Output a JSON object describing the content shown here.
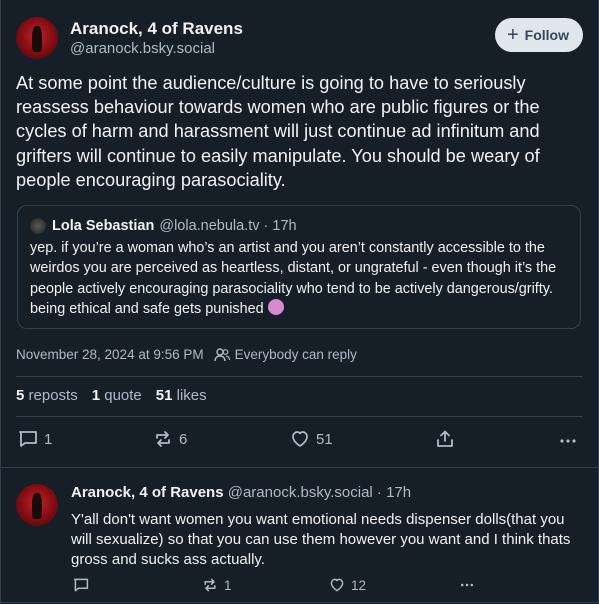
{
  "post": {
    "display_name": "Aranock, 4 of Ravens",
    "handle": "@aranock.bsky.social",
    "follow_label": "Follow",
    "text": "At some point the audience/culture is going to have to seriously reassess behaviour towards women who are public figures or the cycles of harm and harassment will just continue ad infinitum and grifters will continue to easily manipulate. You should be weary of people encouraging parasociality.",
    "quote": {
      "display_name": "Lola Sebastian",
      "handle_time": "@lola.nebula.tv · 17h",
      "text": "yep. if you’re a woman who’s an artist and you aren’t constantly accessible to the weirdos you are perceived as heartless, distant, or ungrateful - even though it’s the people actively encouraging parasociality who tend to be actively dangerous/grifty. being ethical and safe gets punished"
    },
    "timestamp": "November 28, 2024 at 9:56 PM",
    "reply_setting": "Everybody can reply",
    "stats": {
      "reposts_count": "5",
      "reposts_label": "reposts",
      "quotes_count": "1",
      "quotes_label": "quote",
      "likes_count": "51",
      "likes_label": "likes"
    },
    "actions": {
      "replies": "1",
      "reposts": "6",
      "likes": "51"
    }
  },
  "reply": {
    "display_name": "Aranock, 4 of Ravens",
    "handle_time": "@aranock.bsky.social · 17h",
    "text": "Y'all don't want women you want emotional needs dispenser dolls(that you will sexualize) so that you can use them however you want and I think thats gross and sucks ass actually.",
    "actions": {
      "reposts": "1",
      "likes": "12"
    }
  },
  "icons": [
    "reply-icon",
    "repost-icon",
    "like-icon",
    "share-icon",
    "more-icon",
    "people-icon",
    "plus-icon"
  ],
  "colors": {
    "background": "#161e27",
    "border": "#2e4052",
    "text": "#f1f3f5",
    "muted": "#aebbc9",
    "follow_bg": "#dfe6ee"
  }
}
